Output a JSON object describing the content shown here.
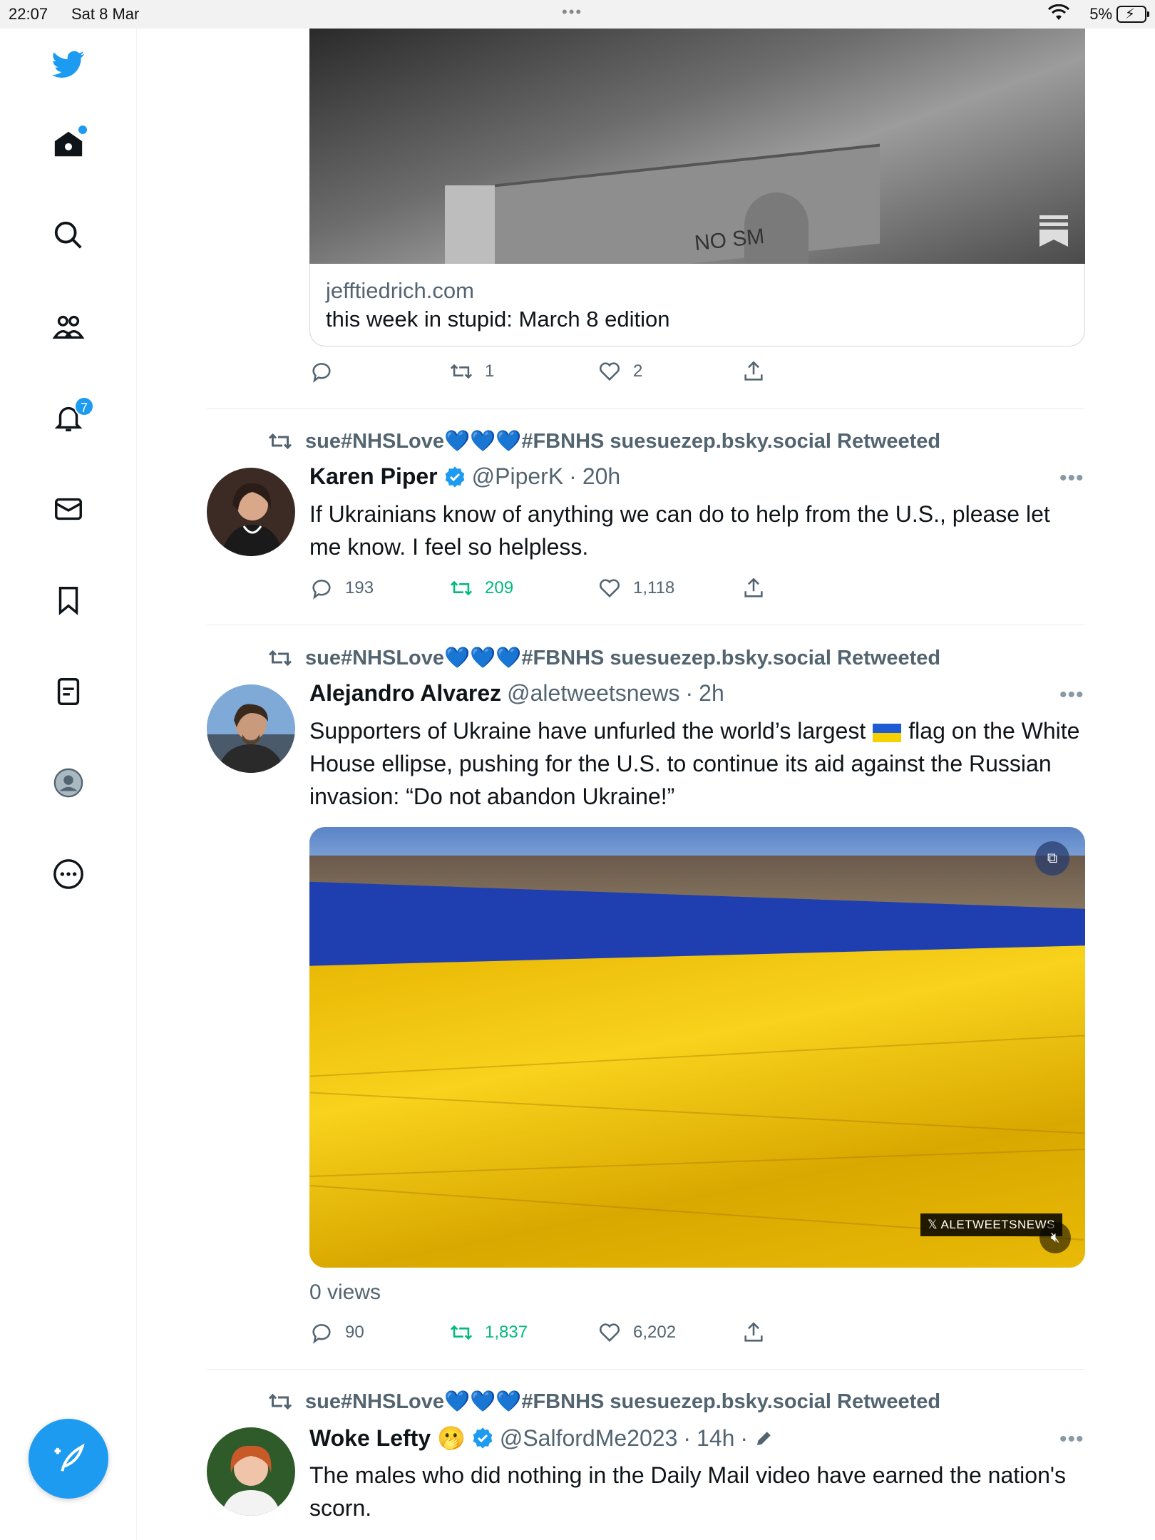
{
  "status_bar": {
    "time": "22:07",
    "date": "Sat 8 Mar",
    "battery_percent": "5%"
  },
  "sidebar": {
    "notifications_badge": "7"
  },
  "tweets": [
    {
      "link_card": {
        "domain": "jefftiedrich.com",
        "headline": "this week in stupid: March 8 edition"
      },
      "actions": {
        "replies": "",
        "retweets": "1",
        "likes": "2"
      }
    },
    {
      "retweeted_by": "sue#NHSLove💙💙💙#FBNHS suesuezep.bsky.social Retweeted",
      "name": "Karen Piper",
      "handle": "@PiperK",
      "time": "20h",
      "text": "If Ukrainians know of anything we can do to help from the U.S., please let me know. I feel so helpless.",
      "actions": {
        "replies": "193",
        "retweets": "209",
        "likes": "1,118"
      }
    },
    {
      "retweeted_by": "sue#NHSLove💙💙💙#FBNHS suesuezep.bsky.social Retweeted",
      "name": "Alejandro Alvarez",
      "handle": "@aletweetsnews",
      "time": "2h",
      "text_before_flag": "Supporters of Ukraine have unfurled the world’s largest",
      "text_after_flag": "flag on the White House ellipse, pushing for the U.S. to continue its aid against the Russian invasion: “Do not abandon Ukraine!”",
      "video_watermark": "𝕏 ALETWEETSNEWS",
      "views": "0 views",
      "actions": {
        "replies": "90",
        "retweets": "1,837",
        "likes": "6,202"
      }
    },
    {
      "retweeted_by": "sue#NHSLove💙💙💙#FBNHS suesuezep.bsky.social Retweeted",
      "name": "Woke Lefty 🫢",
      "handle": "@SalfordMe2023",
      "time": "14h",
      "text": "The males who did nothing in the Daily Mail video have earned the nation's scorn."
    }
  ],
  "icons": [
    "twitter-logo-icon",
    "home-icon",
    "search-icon",
    "communities-icon",
    "notifications-icon",
    "messages-icon",
    "bookmarks-icon",
    "lists-icon",
    "profile-icon",
    "more-icon",
    "compose-icon",
    "reply-icon",
    "retweet-icon",
    "like-icon",
    "share-icon",
    "verified-icon",
    "edit-icon"
  ],
  "colors": {
    "brand": "#1d9bf0",
    "retweet_active": "#00ba7c",
    "secondary_text": "#536471"
  }
}
